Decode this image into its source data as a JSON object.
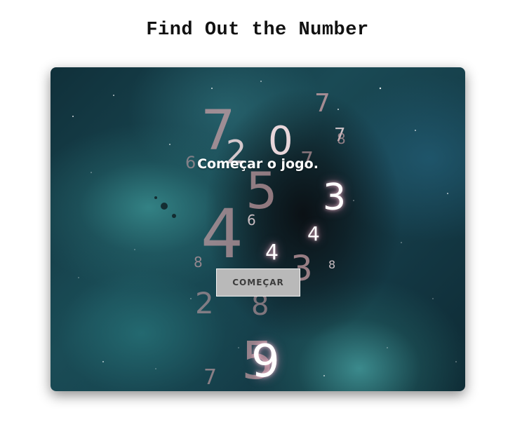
{
  "page": {
    "title": "Find Out the Number"
  },
  "game": {
    "prompt": "Começar o jogo.",
    "start_button_label": "COMEÇAR",
    "floating_numbers": [
      "7",
      "0",
      "2",
      "7",
      "7",
      "8",
      "6",
      "7",
      "5",
      "3",
      "4",
      "6",
      "4",
      "4",
      "8",
      "3",
      "8",
      "8",
      "2",
      "8",
      "5",
      "9",
      "7"
    ]
  },
  "colors": {
    "board_background": "#1a4a55",
    "number_pink": "#c79ea4",
    "number_glow": "#ffffff",
    "button_background": "#b9b9b9"
  }
}
